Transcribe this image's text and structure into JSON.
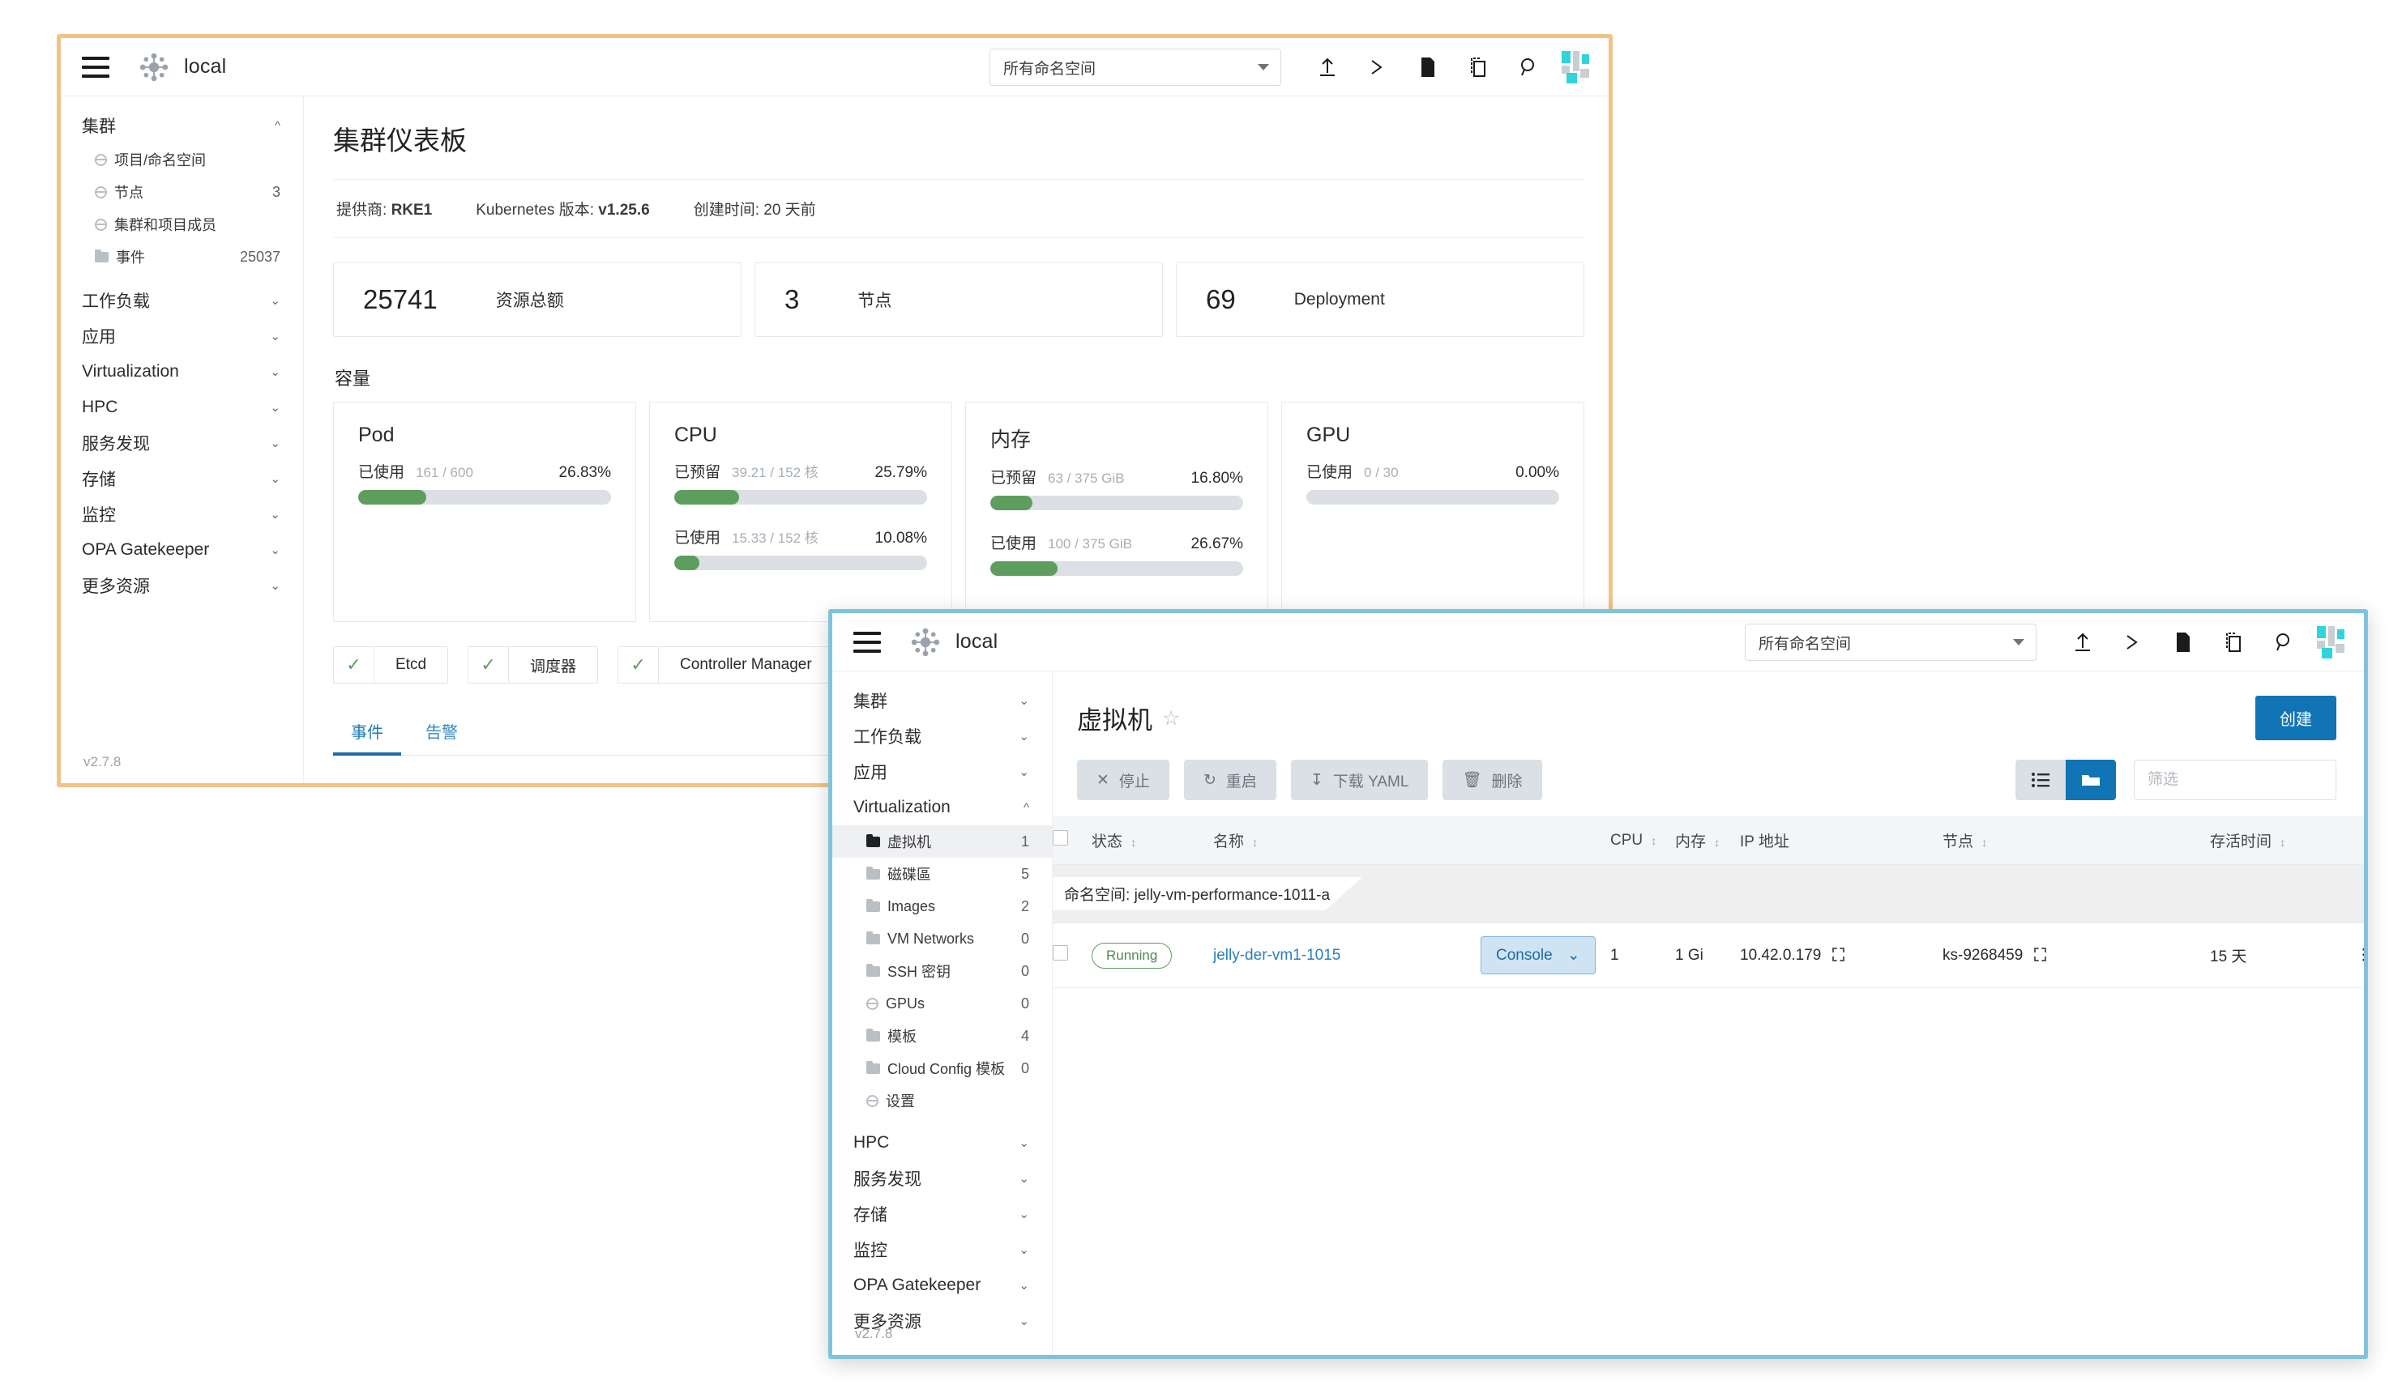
{
  "back_window": {
    "header": {
      "cluster_name": "local",
      "namespace_select": "所有命名空间",
      "icons": [
        "menu-icon",
        "cluster-icon",
        "upload-icon",
        "shell-icon",
        "file-icon",
        "copy-icon",
        "search-icon",
        "logo-icon"
      ]
    },
    "sidebar": {
      "groups": [
        {
          "label": "集群",
          "expanded": true,
          "items": [
            {
              "label": "项目/命名空间",
              "count": "",
              "icon": "globe-icon"
            },
            {
              "label": "节点",
              "count": "3",
              "icon": "globe-icon"
            },
            {
              "label": "集群和项目成员",
              "count": "",
              "icon": "globe-icon"
            },
            {
              "label": "事件",
              "count": "25037",
              "icon": "folder-icon"
            }
          ]
        },
        {
          "label": "工作负载",
          "expanded": false,
          "items": []
        },
        {
          "label": "应用",
          "expanded": false,
          "items": []
        },
        {
          "label": "Virtualization",
          "expanded": false,
          "items": []
        },
        {
          "label": "HPC",
          "expanded": false,
          "items": []
        },
        {
          "label": "服务发现",
          "expanded": false,
          "items": []
        },
        {
          "label": "存储",
          "expanded": false,
          "items": []
        },
        {
          "label": "监控",
          "expanded": false,
          "items": []
        },
        {
          "label": "OPA Gatekeeper",
          "expanded": false,
          "items": []
        },
        {
          "label": "更多资源",
          "expanded": false,
          "items": []
        }
      ],
      "version": "v2.7.8"
    },
    "main": {
      "title": "集群仪表板",
      "meta": [
        {
          "key": "提供商:",
          "value": "RKE1"
        },
        {
          "key": "Kubernetes 版本:",
          "value": "v1.25.6"
        },
        {
          "key": "创建时间:",
          "value": "20 天前"
        }
      ],
      "stats": [
        {
          "value": "25741",
          "label": "资源总额"
        },
        {
          "value": "3",
          "label": "节点"
        },
        {
          "value": "69",
          "label": "Deployment"
        }
      ],
      "capacity_title": "容量",
      "capacity": [
        {
          "name": "Pod",
          "lines": [
            {
              "label": "已使用",
              "fraction": "161 / 600",
              "percent": "26.83%",
              "value": 26.83
            }
          ]
        },
        {
          "name": "CPU",
          "lines": [
            {
              "label": "已预留",
              "fraction": "39.21 / 152 核",
              "percent": "25.79%",
              "value": 25.79
            },
            {
              "label": "已使用",
              "fraction": "15.33 / 152 核",
              "percent": "10.08%",
              "value": 10.08
            }
          ]
        },
        {
          "name": "内存",
          "lines": [
            {
              "label": "已预留",
              "fraction": "63 / 375 GiB",
              "percent": "16.80%",
              "value": 16.8
            },
            {
              "label": "已使用",
              "fraction": "100 / 375 GiB",
              "percent": "26.67%",
              "value": 26.67
            }
          ]
        },
        {
          "name": "GPU",
          "lines": [
            {
              "label": "已使用",
              "fraction": "0 / 30",
              "percent": "0.00%",
              "value": 0
            }
          ]
        }
      ],
      "components": [
        {
          "label": "Etcd",
          "status": "healthy"
        },
        {
          "label": "调度器",
          "status": "healthy"
        },
        {
          "label": "Controller Manager",
          "status": "healthy"
        }
      ],
      "tabs": [
        {
          "label": "事件",
          "active": true
        },
        {
          "label": "告警",
          "active": false
        }
      ]
    }
  },
  "front_window": {
    "header": {
      "cluster_name": "local",
      "namespace_select": "所有命名空间"
    },
    "sidebar": {
      "groups": [
        {
          "label": "集群",
          "expanded": false
        },
        {
          "label": "工作负载",
          "expanded": false
        },
        {
          "label": "应用",
          "expanded": false
        },
        {
          "label": "Virtualization",
          "expanded": true
        },
        {
          "label": "HPC",
          "expanded": false
        },
        {
          "label": "服务发现",
          "expanded": false
        },
        {
          "label": "存储",
          "expanded": false
        },
        {
          "label": "监控",
          "expanded": false
        },
        {
          "label": "OPA Gatekeeper",
          "expanded": false
        },
        {
          "label": "更多资源",
          "expanded": false
        }
      ],
      "virtualization_items": [
        {
          "label": "虚拟机",
          "count": "1",
          "icon": "folder-icon",
          "active": true
        },
        {
          "label": "磁碟區",
          "count": "5",
          "icon": "folder-icon",
          "active": false
        },
        {
          "label": "Images",
          "count": "2",
          "icon": "folder-icon",
          "active": false
        },
        {
          "label": "VM Networks",
          "count": "0",
          "icon": "folder-icon",
          "active": false
        },
        {
          "label": "SSH 密钥",
          "count": "0",
          "icon": "folder-icon",
          "active": false
        },
        {
          "label": "GPUs",
          "count": "0",
          "icon": "globe-icon",
          "active": false
        },
        {
          "label": "模板",
          "count": "4",
          "icon": "folder-icon",
          "active": false
        },
        {
          "label": "Cloud Config 模板",
          "count": "0",
          "icon": "folder-icon",
          "active": false
        },
        {
          "label": "设置",
          "count": "",
          "icon": "globe-icon",
          "active": false
        }
      ],
      "version": "v2.7.8"
    },
    "page": {
      "title": "虚拟机",
      "create_label": "创建",
      "actions": [
        {
          "label": "停止",
          "icon": "close-icon"
        },
        {
          "label": "重启",
          "icon": "refresh-icon"
        },
        {
          "label": "下载 YAML",
          "icon": "download-icon"
        },
        {
          "label": "删除",
          "icon": "trash-icon"
        }
      ],
      "view_toggle": [
        {
          "icon": "list-view-icon",
          "active": false
        },
        {
          "icon": "group-view-icon",
          "active": true
        }
      ],
      "filter_placeholder": "筛选",
      "table": {
        "columns": [
          "状态",
          "名称",
          "",
          "CPU",
          "内存",
          "IP 地址",
          "节点",
          "存活时间"
        ],
        "group_label": "命名空间:",
        "group_value": "jelly-vm-performance-1011-a",
        "rows": [
          {
            "status": "Running",
            "name": "jelly-der-vm1-1015",
            "console_label": "Console",
            "cpu": "1",
            "memory": "1 Gi",
            "ip": "10.42.0.179",
            "node": "ks-9268459",
            "age": "15 天"
          }
        ]
      }
    }
  }
}
